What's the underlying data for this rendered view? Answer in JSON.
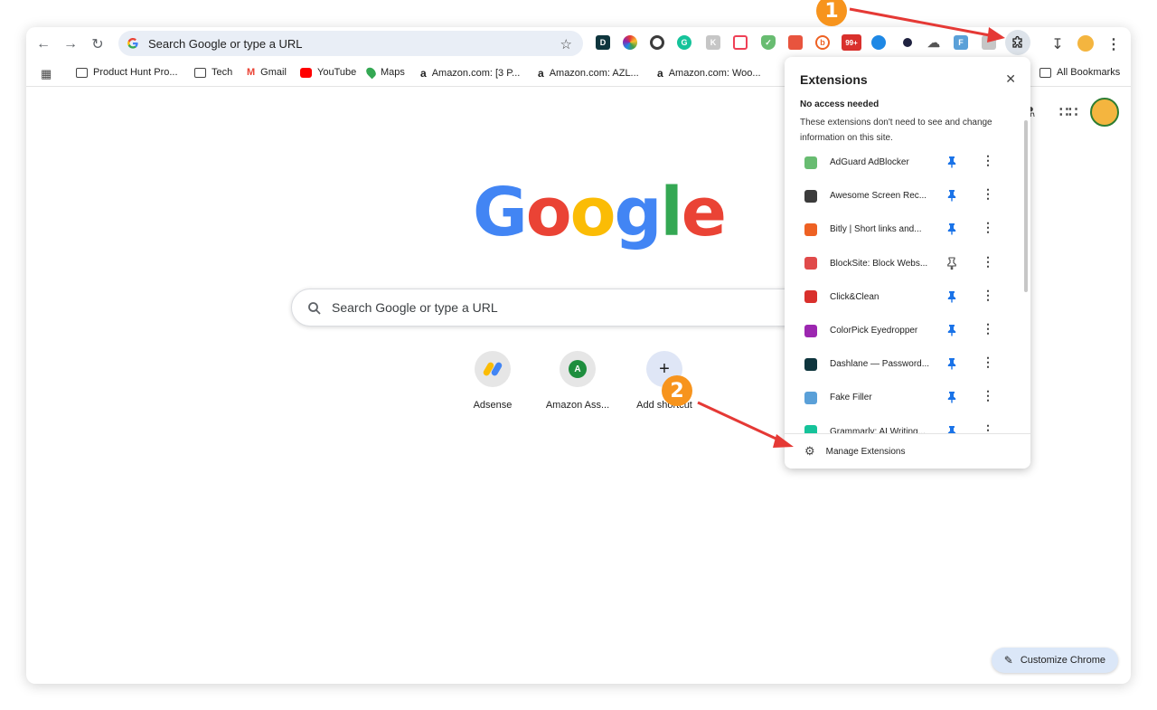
{
  "browser": {
    "omnibox_text": "Search Google or type a URL"
  },
  "bookmarks": [
    {
      "label": "Product Hunt Pro...",
      "icon": "folder-icon"
    },
    {
      "label": "Tech",
      "icon": "folder-icon"
    },
    {
      "label": "Gmail",
      "icon": "gmail-icon"
    },
    {
      "label": "YouTube",
      "icon": "youtube-icon"
    },
    {
      "label": "Maps",
      "icon": "maps-icon"
    },
    {
      "label": "Amazon.com: [3 P...",
      "icon": "amazon-icon"
    },
    {
      "label": "Amazon.com: AZL...",
      "icon": "amazon-icon"
    },
    {
      "label": "Amazon.com: Woo...",
      "icon": "amazon-icon"
    },
    {
      "label": "All Bookmarks",
      "icon": "folder-icon"
    }
  ],
  "toolbar_badge": "99+",
  "google": {
    "search_placeholder": "Search Google or type a URL",
    "shortcuts": [
      {
        "label": "Adsense",
        "initial": ""
      },
      {
        "label": "Amazon Ass...",
        "initial": "A"
      },
      {
        "label": "Add shortcut",
        "initial": "+"
      }
    ],
    "customize_label": "Customize Chrome"
  },
  "extensions_panel": {
    "title": "Extensions",
    "section_title": "No access needed",
    "section_desc": "These extensions don't need to see and change information on this site.",
    "items": [
      {
        "name": "AdGuard AdBlocker",
        "pinned": true,
        "color": "#68bc71"
      },
      {
        "name": "Awesome Screen Rec...",
        "pinned": true,
        "color": "#3b3b3b"
      },
      {
        "name": "Bitly | Short links and...",
        "pinned": true,
        "color": "#ee6123"
      },
      {
        "name": "BlockSite: Block Webs...",
        "pinned": false,
        "color": "#e04a4a"
      },
      {
        "name": "Click&Clean",
        "pinned": true,
        "color": "#d9302c"
      },
      {
        "name": "ColorPick Eyedropper",
        "pinned": true,
        "color": "#9c27b0"
      },
      {
        "name": "Dashlane — Password...",
        "pinned": true,
        "color": "#0e353d"
      },
      {
        "name": "Fake Filler",
        "pinned": true,
        "color": "#5aa0d8"
      },
      {
        "name": "Grammarly: AI Writing...",
        "pinned": true,
        "color": "#15c39a"
      }
    ],
    "manage_label": "Manage Extensions"
  },
  "annotations": {
    "step1": "1",
    "step2": "2"
  }
}
